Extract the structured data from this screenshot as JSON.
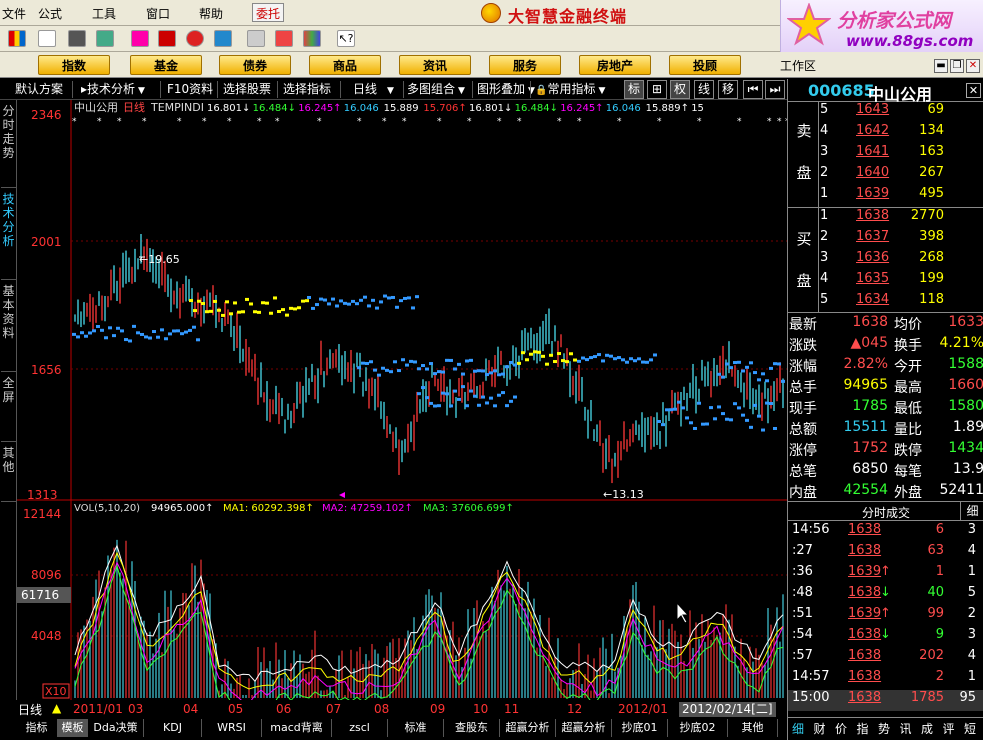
{
  "menu": {
    "items": [
      "文件",
      "公式",
      "工具",
      "窗口",
      "帮助"
    ],
    "entrust": "委托"
  },
  "app_title": "大智慧金融终端",
  "brand": {
    "line1": "分析家公式网",
    "line2": "www.88gs.com"
  },
  "nav_tabs": [
    "指数",
    "基金",
    "债券",
    "商品",
    "资讯",
    "服务",
    "房地产",
    "投顾"
  ],
  "workarea": "工作区",
  "funcbar": {
    "items": [
      "默认方案",
      "技术分析",
      "F10资料",
      "选择股票",
      "选择指标",
      "日线",
      "多图组合",
      "图形叠加",
      "常用指标"
    ],
    "buttons": [
      "标",
      "⊞",
      "权",
      "线",
      "移"
    ]
  },
  "left_tabs": [
    "分时走势",
    "技术分析",
    "基本资料",
    "全屏",
    "其他"
  ],
  "price_chart": {
    "header_name": "中山公用",
    "header_period": "日线",
    "indicator": "TEMPINDI",
    "values": [
      "16.801↓",
      "16.484↓",
      "16.245↑",
      "16.046",
      "15.889",
      "15.706↑",
      "16.801↓",
      "16.484↓",
      "16.245↑",
      "16.046",
      "15.889↑",
      "15"
    ],
    "axis_labels": [
      "2346",
      "2001",
      "1656",
      "1313"
    ],
    "high_label": "19.65",
    "low_label": "13.13"
  },
  "vol_chart": {
    "header": "VOL(5,10,20)",
    "vol": "94965.000↑",
    "ma1": "MA1: 60292.398↑",
    "ma2": "MA2: 47259.102↑",
    "ma3": "MA3: 37606.699↑",
    "axis_labels": [
      "12144",
      "8096",
      "4048"
    ],
    "current": "61716",
    "unit": "X10"
  },
  "date_axis": [
    "2011/01",
    "03",
    "04",
    "05",
    "06",
    "07",
    "08",
    "09",
    "10",
    "11",
    "12",
    "2012/01"
  ],
  "date_current": "2012/02/14[二]",
  "stock": {
    "code": "000685",
    "name": "中山公用"
  },
  "orderbook": {
    "sell_label": [
      "卖",
      "盘"
    ],
    "buy_label": [
      "买",
      "盘"
    ],
    "sell": [
      {
        "level": "5",
        "price": "1643",
        "qty": "69"
      },
      {
        "level": "4",
        "price": "1642",
        "qty": "134"
      },
      {
        "level": "3",
        "price": "1641",
        "qty": "163"
      },
      {
        "level": "2",
        "price": "1640",
        "qty": "267"
      },
      {
        "level": "1",
        "price": "1639",
        "qty": "495"
      }
    ],
    "buy": [
      {
        "level": "1",
        "price": "1638",
        "qty": "2770"
      },
      {
        "level": "2",
        "price": "1637",
        "qty": "398"
      },
      {
        "level": "3",
        "price": "1636",
        "qty": "268"
      },
      {
        "level": "4",
        "price": "1635",
        "qty": "199"
      },
      {
        "level": "5",
        "price": "1634",
        "qty": "118"
      }
    ]
  },
  "quote": [
    {
      "l1": "最新",
      "v1": "1638",
      "c1": "red",
      "l2": "均价",
      "v2": "1633",
      "c2": "red"
    },
    {
      "l1": "涨跌",
      "v1": "▲045",
      "c1": "red",
      "l2": "换手",
      "v2": "4.21%",
      "c2": "yellow"
    },
    {
      "l1": "涨幅",
      "v1": "2.82%",
      "c1": "red",
      "l2": "今开",
      "v2": "1588",
      "c2": "green"
    },
    {
      "l1": "总手",
      "v1": "94965",
      "c1": "yellow",
      "l2": "最高",
      "v2": "1660",
      "c2": "red"
    },
    {
      "l1": "现手",
      "v1": "1785",
      "c1": "green",
      "l2": "最低",
      "v2": "1580",
      "c2": "green"
    },
    {
      "l1": "总额",
      "v1": "15511",
      "c1": "cyan",
      "l2": "量比",
      "v2": "1.89",
      "c2": "white"
    },
    {
      "l1": "涨停",
      "v1": "1752",
      "c1": "red",
      "l2": "跌停",
      "v2": "1434",
      "c2": "green"
    },
    {
      "l1": "总笔",
      "v1": "6850",
      "c1": "white",
      "l2": "每笔",
      "v2": "13.9",
      "c2": "white"
    },
    {
      "l1": "内盘",
      "v1": "42554",
      "c1": "green",
      "l2": "外盘",
      "v2": "52411",
      "c2": "white"
    }
  ],
  "ticks": {
    "header": "分时成交",
    "tab": "细",
    "rows": [
      {
        "time": "14:56",
        "price": "1638",
        "arrow": "",
        "vol": "6",
        "vcolor": "red",
        "cnt": "3"
      },
      {
        "time": ":27",
        "price": "1638",
        "arrow": "",
        "vol": "63",
        "vcolor": "red",
        "cnt": "4"
      },
      {
        "time": ":36",
        "price": "1639",
        "arrow": "↑",
        "vol": "1",
        "vcolor": "red",
        "cnt": "1"
      },
      {
        "time": ":48",
        "price": "1638",
        "arrow": "↓",
        "vol": "40",
        "vcolor": "green",
        "cnt": "5"
      },
      {
        "time": ":51",
        "price": "1639",
        "arrow": "↑",
        "vol": "99",
        "vcolor": "red",
        "cnt": "2"
      },
      {
        "time": ":54",
        "price": "1638",
        "arrow": "↓",
        "vol": "9",
        "vcolor": "green",
        "cnt": "3"
      },
      {
        "time": ":57",
        "price": "1638",
        "arrow": "",
        "vol": "202",
        "vcolor": "red",
        "cnt": "4"
      },
      {
        "time": "14:57",
        "price": "1638",
        "arrow": "",
        "vol": "2",
        "vcolor": "red",
        "cnt": "1"
      },
      {
        "time": "15:00",
        "price": "1638",
        "arrow": "",
        "vol": "1785",
        "vcolor": "red",
        "cnt": "95"
      }
    ]
  },
  "right_tabs": [
    "细",
    "财",
    "价",
    "指",
    "势",
    "讯",
    "成",
    "评",
    "短"
  ],
  "bottom_tabs": [
    "指标",
    "模板",
    "Dda决策",
    "KDJ",
    "WRSI",
    "macd背离",
    "zscl",
    "标准",
    "查股东",
    "超赢分析",
    "超赢分析",
    "抄底01",
    "抄底02",
    "其他"
  ],
  "period_label": "日线"
}
